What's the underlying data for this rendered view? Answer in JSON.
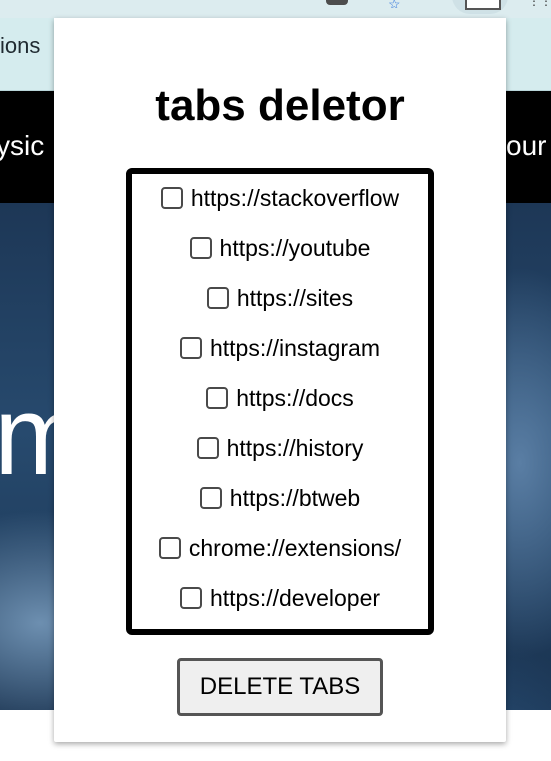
{
  "background": {
    "bookmarks_bar_text": "ions",
    "header_text_left": "ysic",
    "header_text_right": "our",
    "hero_text": "m"
  },
  "popup": {
    "title": "tabs deletor",
    "tabs": [
      {
        "label": "https://stackoverflow",
        "checked": false
      },
      {
        "label": "https://youtube",
        "checked": false
      },
      {
        "label": "https://sites",
        "checked": false
      },
      {
        "label": "https://instagram",
        "checked": false
      },
      {
        "label": "https://docs",
        "checked": false
      },
      {
        "label": "https://history",
        "checked": false
      },
      {
        "label": "https://btweb",
        "checked": false
      },
      {
        "label": "chrome://extensions/",
        "checked": false
      },
      {
        "label": "https://developer",
        "checked": false
      }
    ],
    "delete_button_label": "DELETE TABS"
  },
  "colors": {
    "list_border": "#000000",
    "button_background": "#efefef",
    "header_background": "#000000"
  }
}
